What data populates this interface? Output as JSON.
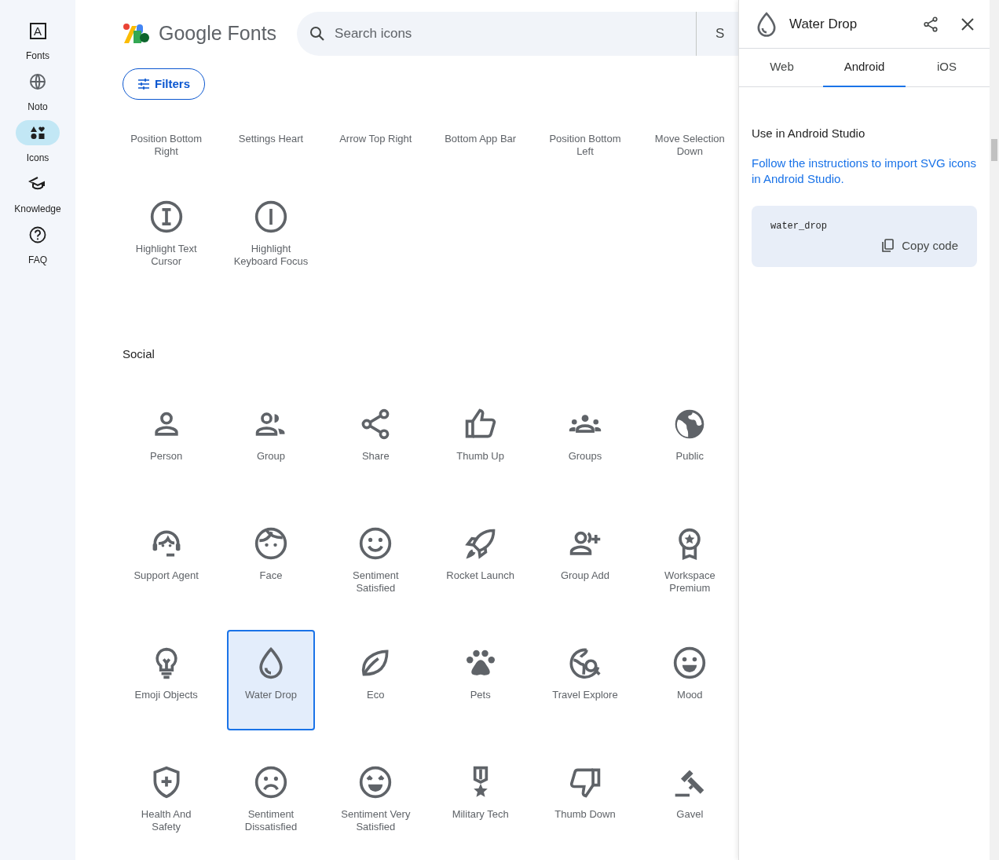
{
  "nav": [
    {
      "label": "Fonts",
      "letter": "A",
      "selected": false
    },
    {
      "label": "Noto",
      "selected": false
    },
    {
      "label": "Icons",
      "selected": true
    },
    {
      "label": "Knowledge",
      "selected": false
    },
    {
      "label": "FAQ",
      "selected": false
    }
  ],
  "header": {
    "logo_text": "Google Fonts",
    "search": {
      "placeholder": "Search icons"
    },
    "search_side_text": "S",
    "filters_button": "Filters"
  },
  "top_grid": {
    "partial_row": [
      "Position Bottom Right",
      "Settings Heart",
      "Arrow Top Right",
      "Bottom App Bar",
      "Position Bottom Left",
      "Move Selection Down"
    ],
    "items": [
      {
        "name": "Highlight Text Cursor",
        "selected": false
      },
      {
        "name": "Highlight Keyboard Focus",
        "selected": false
      }
    ]
  },
  "social": {
    "title": "Social",
    "items": [
      {
        "name": "Person",
        "selected": false
      },
      {
        "name": "Group",
        "selected": false
      },
      {
        "name": "Share",
        "selected": false
      },
      {
        "name": "Thumb Up",
        "selected": false
      },
      {
        "name": "Groups",
        "selected": false
      },
      {
        "name": "Public",
        "selected": false
      },
      {
        "name": "Support Agent",
        "selected": false
      },
      {
        "name": "Face",
        "selected": false
      },
      {
        "name": "Sentiment Satisfied",
        "selected": false
      },
      {
        "name": "Rocket Launch",
        "selected": false
      },
      {
        "name": "Group Add",
        "selected": false
      },
      {
        "name": "Workspace Premium",
        "selected": false
      },
      {
        "name": "Emoji Objects",
        "selected": false
      },
      {
        "name": "Water Drop",
        "selected": true
      },
      {
        "name": "Eco",
        "selected": false
      },
      {
        "name": "Pets",
        "selected": false
      },
      {
        "name": "Travel Explore",
        "selected": false
      },
      {
        "name": "Mood",
        "selected": false
      },
      {
        "name": "Health And Safety",
        "selected": false
      },
      {
        "name": "Sentiment Dissatisfied",
        "selected": false
      },
      {
        "name": "Sentiment Very Satisfied",
        "selected": false
      },
      {
        "name": "Military Tech",
        "selected": false
      },
      {
        "name": "Thumb Down",
        "selected": false
      },
      {
        "name": "Gavel",
        "selected": false
      }
    ]
  },
  "panel": {
    "title": "Water Drop",
    "tabs": [
      {
        "label": "Web",
        "selected": false
      },
      {
        "label": "Android",
        "selected": true
      },
      {
        "label": "iOS",
        "selected": false
      }
    ],
    "heading": "Use in Android Studio",
    "link": "Follow the instructions to import SVG icons in Android Studio.",
    "code": "water_drop",
    "copy_button": "Copy code"
  }
}
